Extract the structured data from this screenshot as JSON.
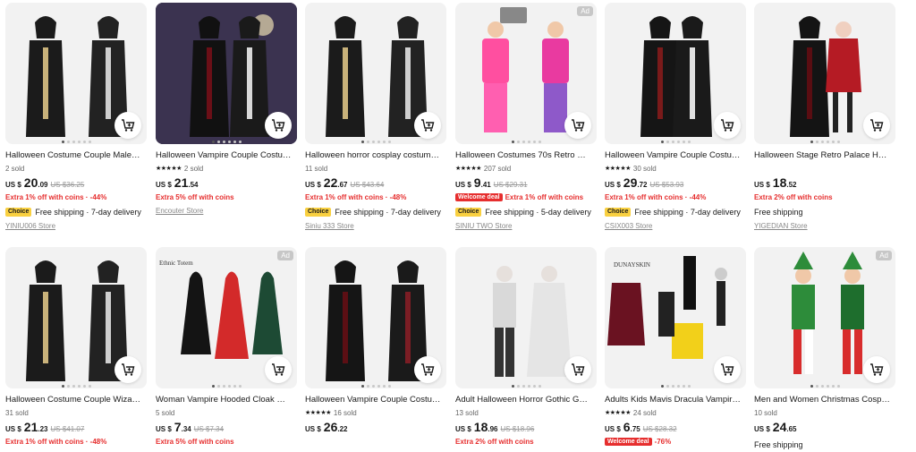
{
  "products": [
    {
      "title": "Halloween Costume Couple Male Wi...",
      "meta": "2 sold",
      "rating": "",
      "currency": "US $",
      "price_int": "20",
      "price_dec": ".09",
      "old_price": "US $36.25",
      "promo": "Extra 1% off with coins · -44%",
      "deal_tag": "",
      "choice": "Choice",
      "shipping": "Free shipping · 7-day delivery",
      "store": "YINIU006 Store",
      "ad": false,
      "art": "robes"
    },
    {
      "title": "Halloween Vampire Couple Costum...",
      "meta": "2 sold",
      "rating": "★★★★★",
      "currency": "US $",
      "price_int": "21",
      "price_dec": ".54",
      "old_price": "",
      "promo": "Extra 5% off with coins",
      "deal_tag": "",
      "choice": "",
      "shipping": "",
      "store": "Encouter Store",
      "ad": false,
      "art": "vampdark"
    },
    {
      "title": "Halloween horror cosplay costumes...",
      "meta": "11 sold",
      "rating": "",
      "currency": "US $",
      "price_int": "22",
      "price_dec": ".67",
      "old_price": "US $43.64",
      "promo": "Extra 1% off with coins · -48%",
      "deal_tag": "",
      "choice": "Choice",
      "shipping": "Free shipping · 7-day delivery",
      "store": "Siniu 333 Store",
      "ad": false,
      "art": "robes"
    },
    {
      "title": "Halloween Costumes 70s Retro Disc...",
      "meta": "207 sold",
      "rating": "★★★★★",
      "currency": "US $",
      "price_int": "9",
      "price_dec": ".41",
      "old_price": "US $29.31",
      "promo": "Extra 1% off with coins",
      "deal_tag": "Welcome deal",
      "choice": "Choice",
      "shipping": "Free shipping · 5-day delivery",
      "store": "SINIU TWO Store",
      "ad": true,
      "art": "retro"
    },
    {
      "title": "Halloween Vampire Couple Costum...",
      "meta": "30 sold",
      "rating": "★★★★★",
      "currency": "US $",
      "price_int": "29",
      "price_dec": ".72",
      "old_price": "US $53.93",
      "promo": "Extra 1% off with coins · -44%",
      "deal_tag": "",
      "choice": "Choice",
      "shipping": "Free shipping · 7-day delivery",
      "store": "CSIX003 Store",
      "ad": false,
      "art": "vamplight"
    },
    {
      "title": "Halloween Stage Retro Palace Horro...",
      "meta": "",
      "rating": "",
      "currency": "US $",
      "price_int": "18",
      "price_dec": ".52",
      "old_price": "",
      "promo": "Extra 2% off with coins",
      "deal_tag": "",
      "choice": "",
      "shipping": "Free shipping",
      "store": "YIGEDIAN Store",
      "ad": false,
      "art": "palace"
    },
    {
      "title": "Halloween Costume Couple Wizard ...",
      "meta": "31 sold",
      "rating": "",
      "currency": "US $",
      "price_int": "21",
      "price_dec": ".23",
      "old_price": "US $41.07",
      "promo": "Extra 1% off with coins · -48%",
      "deal_tag": "",
      "choice": "",
      "shipping": "",
      "store": "",
      "ad": false,
      "art": "robes"
    },
    {
      "title": "Woman Vampire Hooded Cloak Wit...",
      "meta": "5 sold",
      "rating": "",
      "currency": "US $",
      "price_int": "7",
      "price_dec": ".34",
      "old_price": "US $7.34",
      "promo": "Extra 5% off with coins",
      "deal_tag": "",
      "choice": "",
      "shipping": "",
      "store": "",
      "ad": true,
      "art": "cloaks",
      "brand": "Ethnic Totem"
    },
    {
      "title": "Halloween Vampire Couple Costum...",
      "meta": "16 sold",
      "rating": "★★★★★",
      "currency": "US $",
      "price_int": "26",
      "price_dec": ".22",
      "old_price": "",
      "promo": "",
      "deal_tag": "",
      "choice": "",
      "shipping": "",
      "store": "",
      "ad": false,
      "art": "vampblack"
    },
    {
      "title": "Adult Halloween Horror Gothic Gho...",
      "meta": "13 sold",
      "rating": "",
      "currency": "US $",
      "price_int": "18",
      "price_dec": ".96",
      "old_price": "US $18.96",
      "promo": "Extra 2% off with coins",
      "deal_tag": "",
      "choice": "",
      "shipping": "",
      "store": "",
      "ad": false,
      "art": "ghost"
    },
    {
      "title": "Adults Kids Mavis Dracula Vampire ...",
      "meta": "24 sold",
      "rating": "★★★★★",
      "currency": "US $",
      "price_int": "6",
      "price_dec": ".75",
      "old_price": "US $28.32",
      "promo": "-76%",
      "deal_tag": "Welcome deal",
      "choice": "",
      "shipping": "",
      "store": "",
      "ad": false,
      "art": "mavis",
      "brand": "DUNAYSKIN"
    },
    {
      "title": "Men and Women Christmas Cospla...",
      "meta": "10 sold",
      "rating": "",
      "currency": "US $",
      "price_int": "24",
      "price_dec": ".65",
      "old_price": "",
      "promo": "",
      "deal_tag": "",
      "choice": "",
      "shipping": "Free shipping",
      "store": "",
      "ad": true,
      "art": "elves"
    }
  ],
  "labels": {
    "ad": "Ad"
  },
  "colors": {
    "accent_red": "#e62e2e",
    "choice_yellow": "#f9d040"
  }
}
